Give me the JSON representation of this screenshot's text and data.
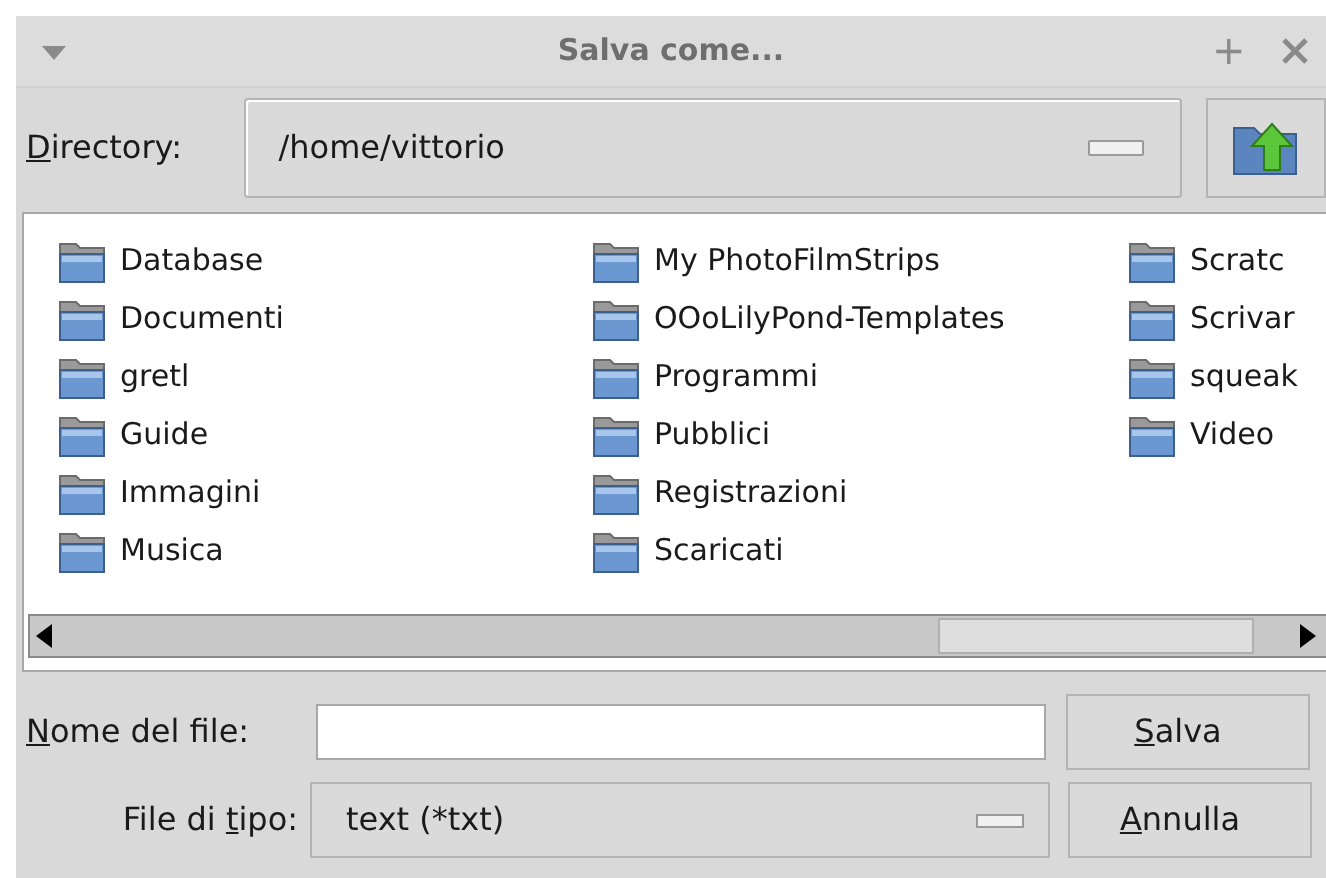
{
  "window": {
    "title": "Salva come...",
    "maximize": "+"
  },
  "directory": {
    "label": [
      {
        "text": "D",
        "underline": true
      },
      {
        "text": "irectory:",
        "underline": false
      }
    ],
    "value": "/home/vittorio"
  },
  "folders": [
    {
      "name": "Database"
    },
    {
      "name": "Documenti"
    },
    {
      "name": "gretl"
    },
    {
      "name": "Guide"
    },
    {
      "name": "Immagini"
    },
    {
      "name": "Musica"
    },
    {
      "name": "My PhotoFilmStrips"
    },
    {
      "name": "OOoLilyPond-Templates"
    },
    {
      "name": "Programmi"
    },
    {
      "name": "Pubblici"
    },
    {
      "name": "Registrazioni"
    },
    {
      "name": "Scaricati"
    },
    {
      "name": "Scratc"
    },
    {
      "name": "Scrivar"
    },
    {
      "name": "squeak"
    },
    {
      "name": "Video"
    }
  ],
  "filename": {
    "label": [
      {
        "text": "N",
        "underline": true
      },
      {
        "text": "ome del file:",
        "underline": false
      }
    ]
  },
  "filetype": {
    "label": [
      {
        "text": "File di ",
        "underline": false
      },
      {
        "text": "t",
        "underline": true
      },
      {
        "text": "ipo:",
        "underline": false
      }
    ],
    "value": "text (*txt)"
  },
  "buttons": [
    {
      "label": [
        {
          "text": "S",
          "underline": true
        },
        {
          "text": "alva",
          "underline": false
        }
      ]
    },
    {
      "label": [
        {
          "text": "A",
          "underline": true
        },
        {
          "text": "nnulla",
          "underline": false
        }
      ]
    }
  ]
}
